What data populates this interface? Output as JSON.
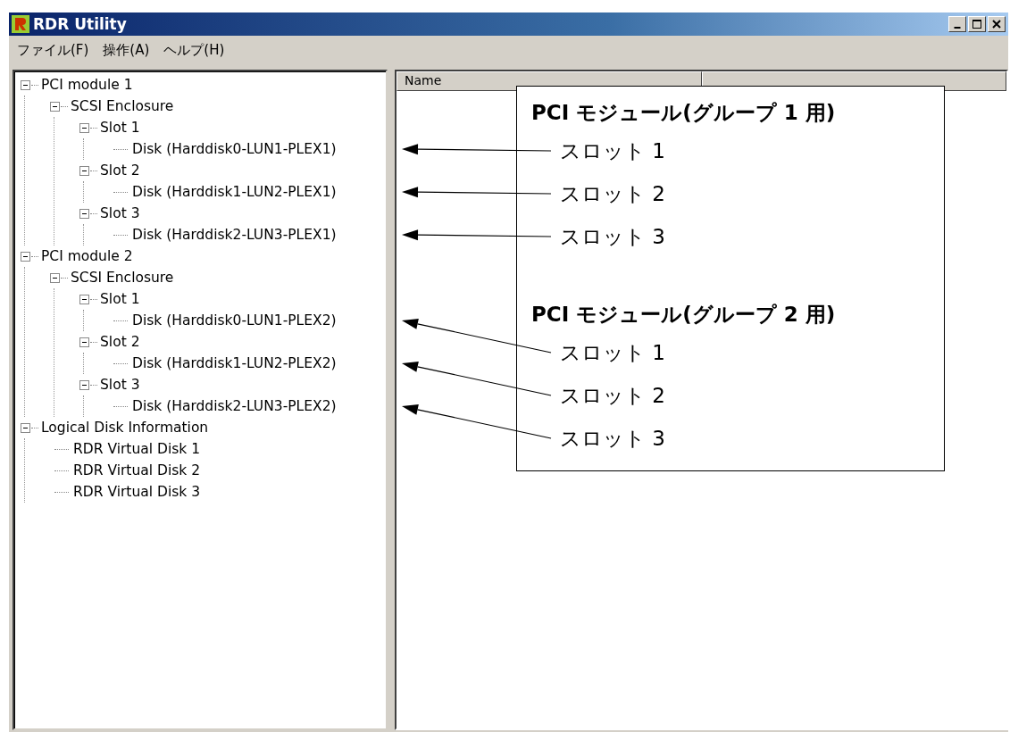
{
  "window": {
    "title": "RDR Utility"
  },
  "menu": [
    {
      "label": "ファイル(F)"
    },
    {
      "label": "操作(A)"
    },
    {
      "label": "ヘルプ(H)"
    }
  ],
  "tree": [
    {
      "label": "PCI module 1",
      "expanded": true,
      "children": [
        {
          "label": "SCSI Enclosure",
          "expanded": true,
          "children": [
            {
              "label": "Slot 1",
              "expanded": true,
              "children": [
                {
                  "label": "Disk (Harddisk0-LUN1-PLEX1)"
                }
              ]
            },
            {
              "label": "Slot 2",
              "expanded": true,
              "children": [
                {
                  "label": "Disk (Harddisk1-LUN2-PLEX1)"
                }
              ]
            },
            {
              "label": "Slot 3",
              "expanded": true,
              "children": [
                {
                  "label": "Disk (Harddisk2-LUN3-PLEX1)"
                }
              ]
            }
          ]
        }
      ]
    },
    {
      "label": "PCI module 2",
      "expanded": true,
      "children": [
        {
          "label": "SCSI Enclosure",
          "expanded": true,
          "children": [
            {
              "label": "Slot 1",
              "expanded": true,
              "children": [
                {
                  "label": "Disk (Harddisk0-LUN1-PLEX2)"
                }
              ]
            },
            {
              "label": "Slot 2",
              "expanded": true,
              "children": [
                {
                  "label": "Disk (Harddisk1-LUN2-PLEX2)"
                }
              ]
            },
            {
              "label": "Slot 3",
              "expanded": true,
              "children": [
                {
                  "label": "Disk (Harddisk2-LUN3-PLEX2)"
                }
              ]
            }
          ]
        }
      ]
    },
    {
      "label": "Logical Disk Information",
      "expanded": true,
      "children": [
        {
          "label": "RDR Virtual Disk 1"
        },
        {
          "label": "RDR Virtual Disk 2"
        },
        {
          "label": "RDR Virtual Disk 3"
        }
      ]
    }
  ],
  "list": {
    "columns": [
      "Name"
    ]
  },
  "callout": {
    "groups": [
      {
        "heading": "PCI モジュール(グループ 1 用)",
        "items": [
          {
            "label": "スロット 1"
          },
          {
            "label": "スロット 2"
          },
          {
            "label": "スロット 3"
          }
        ]
      },
      {
        "heading": "PCI モジュール(グループ 2 用)",
        "items": [
          {
            "label": "スロット 1"
          },
          {
            "label": "スロット 2"
          },
          {
            "label": "スロット 3"
          }
        ]
      }
    ]
  }
}
